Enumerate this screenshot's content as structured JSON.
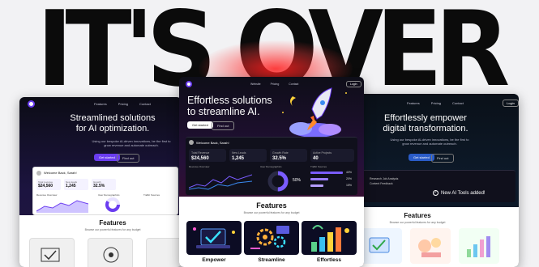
{
  "headline": "IT'S OVER",
  "left_card": {
    "nav": [
      "Features",
      "Pricing",
      "Contact"
    ],
    "hero_line1": "Streamlined solutions",
    "hero_line2": "for AI optimization.",
    "sub": "Using our bespoke AI-driven innovations, be the first to grow revenue and automate outreach.",
    "btn_primary": "Get started",
    "btn_secondary": "Find out",
    "dash_greeting": "Welcome Back, Sarah!",
    "stats": [
      {
        "label": "Total revenue",
        "value": "$24,560"
      },
      {
        "label": "New leads",
        "value": "1,245"
      },
      {
        "label": "Growth",
        "value": "32.5%"
      }
    ],
    "panels": [
      "Revenue Overview",
      "User Demographics",
      "Traffic Sources"
    ],
    "features_title": "Features",
    "features_sub": "Browse our powerful features for any budget"
  },
  "center_card": {
    "nav": [
      "Website",
      "Pricing",
      "Contact"
    ],
    "login": "Login",
    "hero_line1": "Effortless solutions",
    "hero_line2": "to streamline AI.",
    "btn_primary": "Get started",
    "btn_secondary": "Find out",
    "dash_greeting": "Welcome Back, Sarah!",
    "stats": [
      {
        "label": "Total Revenue",
        "value": "$24,560"
      },
      {
        "label": "New Leads",
        "value": "1,245"
      },
      {
        "label": "Growth Rate",
        "value": "32.5%"
      },
      {
        "label": "Active Projects",
        "value": "40"
      }
    ],
    "panels": [
      "Revenue Overview",
      "User Demographics",
      "Traffic Sources"
    ],
    "donut_value": "50%",
    "traffic_values": [
      "40%",
      "20%",
      "15%"
    ],
    "features_title": "Features",
    "features_sub": "Browse our powerful features for any budget",
    "tiles": [
      "Empower",
      "Streamline",
      "Effortless"
    ]
  },
  "right_card": {
    "nav": [
      "Features",
      "Pricing",
      "Contact"
    ],
    "login": "Login",
    "hero_line1": "Effortlessly empower",
    "hero_line2": "digital transformation.",
    "sub": "Using our bespoke AI-driven innovations, be the first to grow revenue and automate outreach.",
    "btn_primary": "Get started",
    "btn_secondary": "Find out",
    "notification": "New AI Tools added!",
    "list_items": [
      "Research Job Analysis",
      "Content Feedback"
    ],
    "features_title": "Features",
    "features_sub": "Browse our powerful features for any budget"
  },
  "colors": {
    "accent": "#6a3cf0",
    "glow": "#ff2a2a",
    "dark_bg": "#0e0e1a",
    "purple_bg": "#2a1448"
  }
}
